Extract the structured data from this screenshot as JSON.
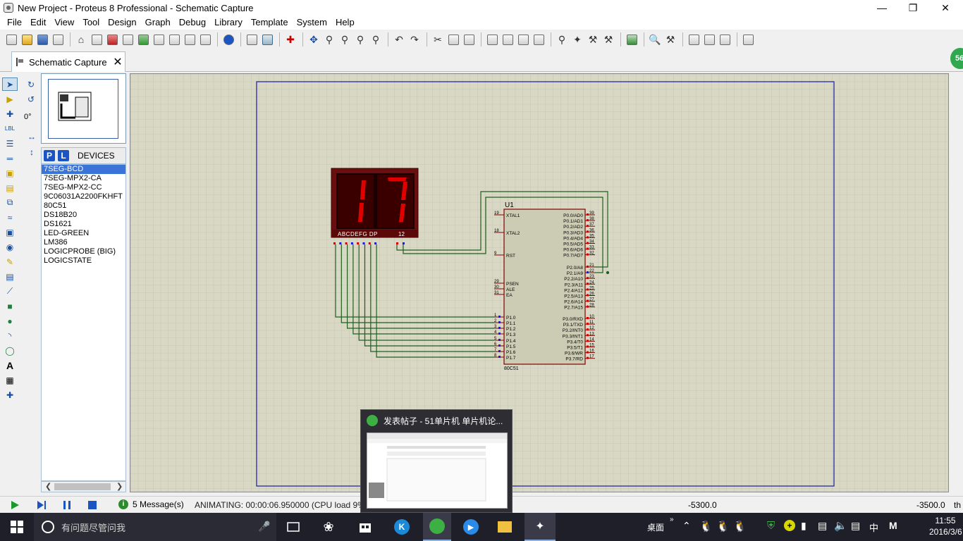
{
  "window": {
    "title": "New Project - Proteus 8 Professional - Schematic Capture"
  },
  "menu": [
    "File",
    "Edit",
    "View",
    "Tool",
    "Design",
    "Graph",
    "Debug",
    "Library",
    "Template",
    "System",
    "Help"
  ],
  "tab": {
    "label": "Schematic Capture"
  },
  "notification_badge": "56",
  "angle": "0°",
  "devices": {
    "p_label": "P",
    "l_label": "L",
    "title": "DEVICES",
    "items": [
      "7SEG-BCD",
      "7SEG-MPX2-CA",
      "7SEG-MPX2-CC",
      "9C06031A2200FKHFT",
      "80C51",
      "DS18B20",
      "DS1621",
      "LED-GREEN",
      "LM386",
      "LOGICPROBE (BIG)",
      "LOGICSTATE"
    ],
    "selected_index": 0
  },
  "schematic": {
    "display": {
      "digits": "17",
      "segments_label": "ABCDEFG  DP",
      "digit_select_label": "12"
    },
    "chip": {
      "ref": "U1",
      "part": "80C51",
      "left_pins": [
        {
          "num": "19",
          "name": "XTAL1"
        },
        {
          "num": "18",
          "name": "XTAL2"
        },
        {
          "num": "9",
          "name": "RST"
        },
        {
          "num": "29",
          "name": "PSEN"
        },
        {
          "num": "30",
          "name": "ALE"
        },
        {
          "num": "31",
          "name": "EA"
        },
        {
          "num": "1",
          "name": "P1.0"
        },
        {
          "num": "2",
          "name": "P1.1"
        },
        {
          "num": "3",
          "name": "P1.2"
        },
        {
          "num": "4",
          "name": "P1.3"
        },
        {
          "num": "5",
          "name": "P1.4"
        },
        {
          "num": "6",
          "name": "P1.5"
        },
        {
          "num": "7",
          "name": "P1.6"
        },
        {
          "num": "8",
          "name": "P1.7"
        }
      ],
      "right_pins_p0": [
        {
          "num": "39",
          "name": "P0.0/AD0"
        },
        {
          "num": "38",
          "name": "P0.1/AD1"
        },
        {
          "num": "37",
          "name": "P0.2/AD2"
        },
        {
          "num": "36",
          "name": "P0.3/AD3"
        },
        {
          "num": "35",
          "name": "P0.4/AD4"
        },
        {
          "num": "34",
          "name": "P0.5/AD5"
        },
        {
          "num": "33",
          "name": "P0.6/AD6"
        },
        {
          "num": "32",
          "name": "P0.7/AD7"
        }
      ],
      "right_pins_p2": [
        {
          "num": "21",
          "name": "P2.0/A8"
        },
        {
          "num": "22",
          "name": "P2.1/A9"
        },
        {
          "num": "23",
          "name": "P2.2/A10"
        },
        {
          "num": "24",
          "name": "P2.3/A11"
        },
        {
          "num": "25",
          "name": "P2.4/A12"
        },
        {
          "num": "26",
          "name": "P2.5/A13"
        },
        {
          "num": "27",
          "name": "P2.6/A14"
        },
        {
          "num": "28",
          "name": "P2.7/A15"
        }
      ],
      "right_pins_p3": [
        {
          "num": "10",
          "name": "P3.0/RXD"
        },
        {
          "num": "11",
          "name": "P3.1/TXD"
        },
        {
          "num": "12",
          "name": "P3.2/INT0"
        },
        {
          "num": "13",
          "name": "P3.3/INT1"
        },
        {
          "num": "14",
          "name": "P3.4/T0"
        },
        {
          "num": "15",
          "name": "P3.5/T1"
        },
        {
          "num": "16",
          "name": "P3.6/WR"
        },
        {
          "num": "17",
          "name": "P3.7/RD"
        }
      ]
    }
  },
  "status": {
    "messages": "5 Message(s)",
    "animating": "ANIMATING: 00:00:06.950000 (CPU load 9%)",
    "coord_x": "-5300.0",
    "coord_y": "-3500.0",
    "units": "th"
  },
  "taskbar": {
    "search_placeholder": "有问题尽管问我",
    "desktop_label": "桌面",
    "ime": "中",
    "ime2": "M",
    "time": "11:55",
    "date": "2016/3/6"
  },
  "thumbnail": {
    "title": "发表帖子 - 51单片机 单片机论..."
  },
  "colors": {
    "canvas_bg": "#d8d8c4",
    "grid": "#c0c0ac",
    "wire": "#1f5f1f",
    "border": "#1a1aa0",
    "chip_fill": "#ccccb4",
    "chip_outline": "#800000",
    "seg_on": "#e00000"
  }
}
